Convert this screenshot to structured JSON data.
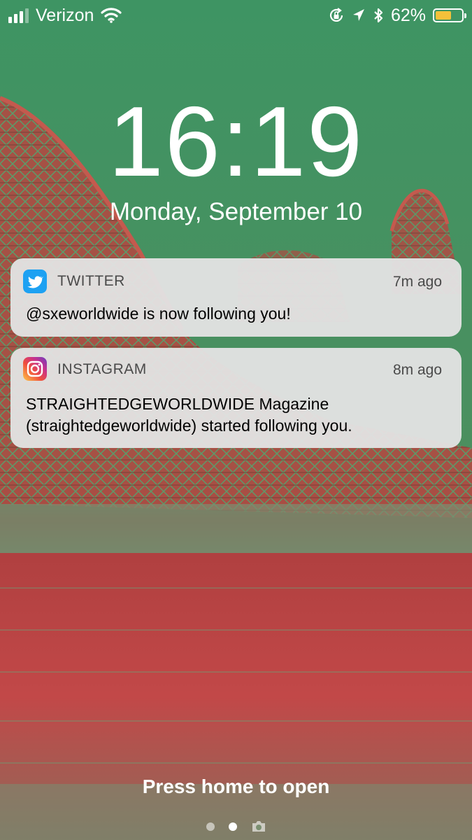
{
  "status_bar": {
    "carrier": "Verizon",
    "battery_percent_label": "62%",
    "battery_level": 0.62,
    "battery_color": "#f3c13a",
    "icons": [
      "signal-icon",
      "wifi-icon",
      "rotation-lock-icon",
      "location-arrow-icon",
      "bluetooth-icon",
      "battery-icon"
    ]
  },
  "lock_screen": {
    "time": "16:19",
    "date": "Monday, September 10",
    "hint": "Press home to open"
  },
  "notifications": [
    {
      "app": "TWITTER",
      "time_ago": "7m ago",
      "message": "@sxeworldwide is now following you!",
      "icon": "twitter-icon",
      "icon_color": "#1da1f2"
    },
    {
      "app": "INSTAGRAM",
      "time_ago": "8m ago",
      "message_line1": "STRAIGHTEDGEWORLDWIDE Magazine",
      "message_line2": "(straightedgeworldwide) started following you.",
      "icon": "instagram-icon"
    }
  ],
  "page_indicator": {
    "pages": 3,
    "active": 2,
    "last_page_icon": "camera-icon"
  }
}
